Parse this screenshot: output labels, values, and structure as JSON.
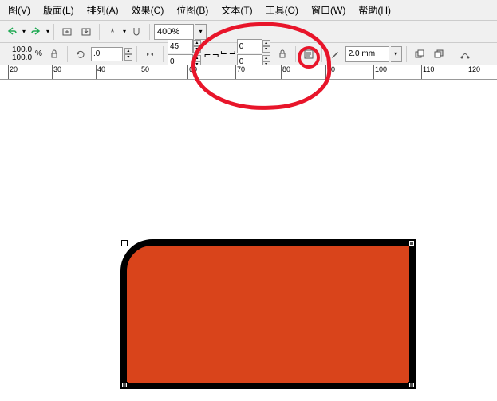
{
  "menu": {
    "view": "图(V)",
    "layout": "版面(L)",
    "arrange": "排列(A)",
    "effects": "效果(C)",
    "bitmap": "位图(B)",
    "text": "文本(T)",
    "tools": "工具(O)",
    "window": "窗口(W)",
    "help": "帮助(H)"
  },
  "toolbar": {
    "zoom": "400%",
    "scale_x": "100.0",
    "scale_y": "100.0",
    "pct": "%",
    "rotation": ".0",
    "corner_a1": "45",
    "corner_a2": "0",
    "corner_b1": "0",
    "corner_b2": "0",
    "stroke_width": "2.0 mm"
  },
  "ruler": {
    "ticks": [
      "20",
      "30",
      "40",
      "50",
      "60",
      "70",
      "80",
      "90",
      "100",
      "110",
      "120"
    ]
  },
  "shape": {
    "fill": "#d9441b",
    "stroke": "#000000",
    "stroke_width": 8,
    "corner_radius_tl": 40
  }
}
